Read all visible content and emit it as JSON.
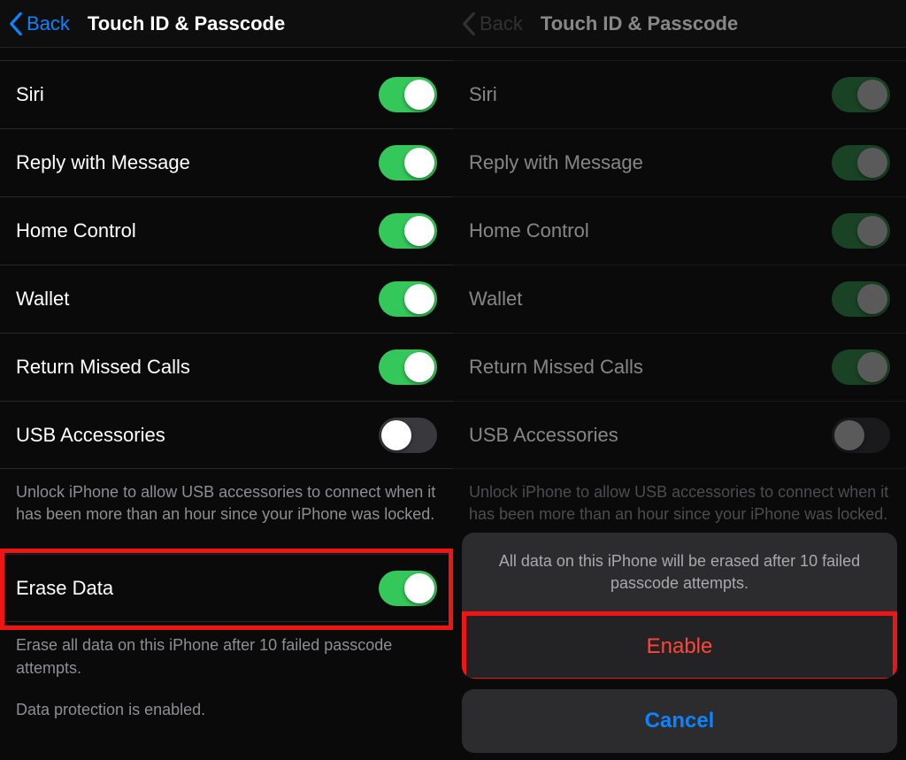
{
  "nav": {
    "back": "Back",
    "title": "Touch ID & Passcode"
  },
  "rows": {
    "siri": "Siri",
    "reply": "Reply with Message",
    "home": "Home Control",
    "wallet": "Wallet",
    "missed": "Return Missed Calls",
    "usb": "USB Accessories"
  },
  "usb_hint": "Unlock iPhone to allow USB accessories to connect when it has been more than an hour since your iPhone was locked.",
  "erase": {
    "label": "Erase Data",
    "hint": "Erase all data on this iPhone after 10 failed passcode attempts.",
    "protection": "Data protection is enabled."
  },
  "sheet": {
    "message": "All data on this iPhone will be erased after 10 failed passcode attempts.",
    "enable": "Enable",
    "cancel": "Cancel"
  },
  "toggles": {
    "siri": true,
    "reply": true,
    "home": true,
    "wallet": true,
    "missed": true,
    "usb": false,
    "erase": true
  }
}
